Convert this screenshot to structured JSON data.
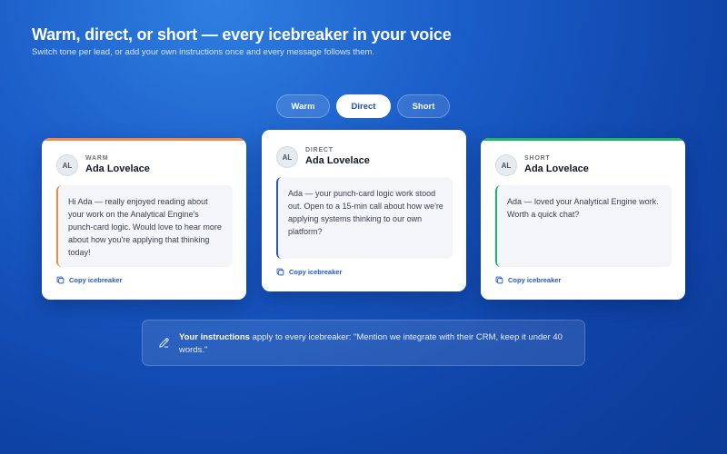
{
  "header": {
    "title": "Warm, direct, or short — every icebreaker in your voice",
    "subtitle": "Switch tone per lead, or add your own instructions once and every message follows them."
  },
  "tabs": [
    {
      "label": "Warm",
      "active": false
    },
    {
      "label": "Direct",
      "active": true
    },
    {
      "label": "Short",
      "active": false
    }
  ],
  "cards": [
    {
      "tone": "WARM",
      "initials": "AL",
      "name": "Ada Lovelace",
      "accent": "#f08a4b",
      "message": "Hi Ada — really enjoyed reading about your work on the Analytical Engine's punch-card logic. Would love to hear more about how you're applying that thinking today!",
      "copy_label": "Copy icebreaker"
    },
    {
      "tone": "DIRECT",
      "initials": "AL",
      "name": "Ada Lovelace",
      "accent": "#2457c5",
      "message": "Ada — your punch-card logic work stood out. Open to a 15-min call about how we're applying systems thinking to our own platform?",
      "copy_label": "Copy icebreaker"
    },
    {
      "tone": "SHORT",
      "initials": "AL",
      "name": "Ada Lovelace",
      "accent": "#22b36a",
      "message": "Ada — loved your Analytical Engine work. Worth a quick chat?",
      "copy_label": "Copy icebreaker"
    }
  ],
  "instructions": {
    "icon": "pencil-icon",
    "lead": "Your instructions",
    "text": " apply to every icebreaker: \"Mention we integrate with their CRM, keep it under 40 words.\""
  }
}
